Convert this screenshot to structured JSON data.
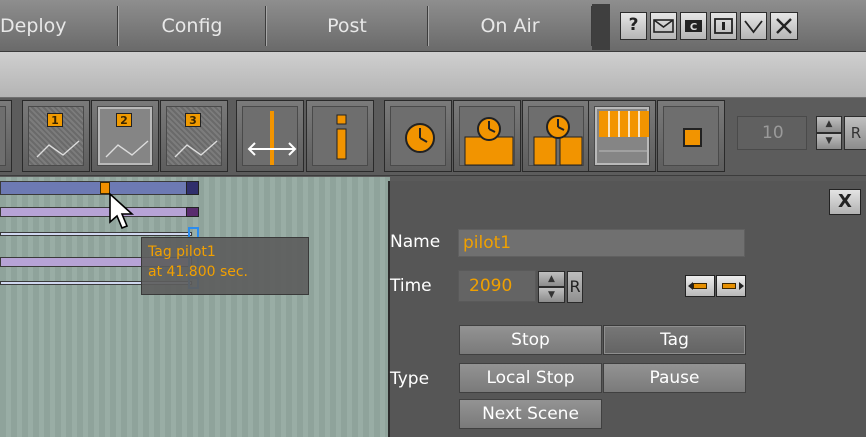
{
  "menu": {
    "tabs": [
      "Deploy",
      "Config",
      "Post",
      "On Air"
    ],
    "window_buttons": [
      "help-icon",
      "mail-icon",
      "console-icon",
      "info-icon",
      "minimize-icon",
      "close-icon"
    ]
  },
  "toolbar": {
    "keyframe_buttons": [
      "1",
      "2",
      "3"
    ],
    "value": "10",
    "reset_label": "R"
  },
  "timeline": {
    "tooltip_line1": "Tag pilot1",
    "tooltip_line2": "at 41.800 sec."
  },
  "panel": {
    "close_label": "X",
    "name_label": "Name",
    "name_value": "pilot1",
    "time_label": "Time",
    "time_value": "2090",
    "reset_label": "R",
    "type_label": "Type",
    "type_options": [
      "Stop",
      "Tag",
      "Local Stop",
      "Pause",
      "Next Scene"
    ]
  },
  "colors": {
    "accent_orange": "#f29400",
    "track_blue": "#6d7ab3",
    "track_lilac": "#b7a3d6",
    "marker_blue": "#2a8cf0"
  }
}
